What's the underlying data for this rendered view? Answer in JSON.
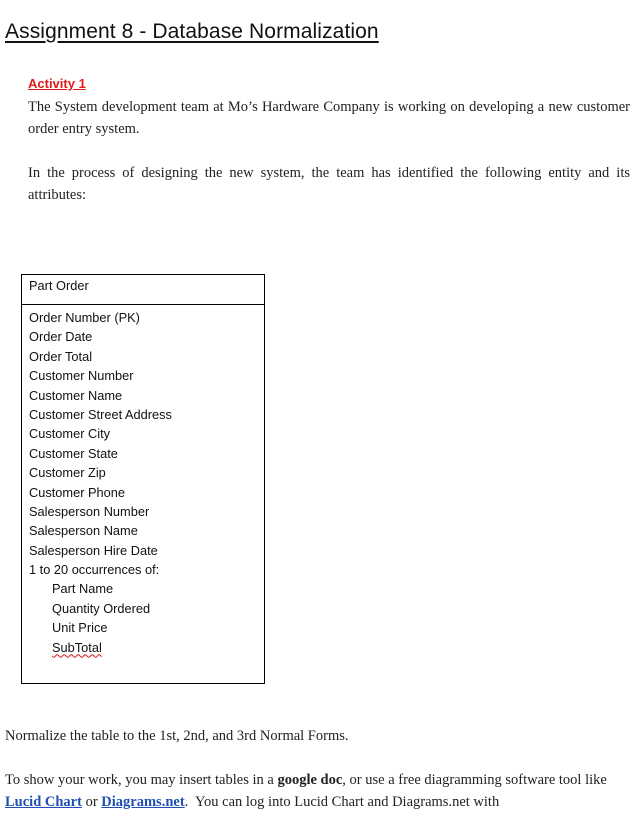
{
  "document": {
    "title": "Assignment 8 - Database Normalization",
    "activity_heading": "Activity 1",
    "intro_paragraph": "The System development team at Mo’s Hardware Company is working on developing a new customer order entry system.",
    "second_paragraph": "In the process of designing the new system, the team has identified the following entity and its attributes:",
    "entity": {
      "name": "Part Order",
      "attributes": [
        {
          "label": "Order Number (PK)",
          "indent": false
        },
        {
          "label": "Order Date",
          "indent": false
        },
        {
          "label": "Order Total",
          "indent": false
        },
        {
          "label": "Customer Number",
          "indent": false
        },
        {
          "label": "Customer Name",
          "indent": false
        },
        {
          "label": "Customer Street Address",
          "indent": false
        },
        {
          "label": "Customer City",
          "indent": false
        },
        {
          "label": "Customer State",
          "indent": false
        },
        {
          "label": "Customer Zip",
          "indent": false
        },
        {
          "label": "Customer Phone",
          "indent": false
        },
        {
          "label": "Salesperson Number",
          "indent": false
        },
        {
          "label": "Salesperson Name",
          "indent": false
        },
        {
          "label": "Salesperson Hire Date",
          "indent": false
        },
        {
          "label": "1 to 20 occurrences of:",
          "indent": false
        },
        {
          "label": "Part Name",
          "indent": true
        },
        {
          "label": "Quantity Ordered",
          "indent": true
        },
        {
          "label": "Unit Price",
          "indent": true
        },
        {
          "label": "SubTotal",
          "indent": true,
          "spellcheck_flag": true
        }
      ]
    },
    "instruction": "Normalize the table to the 1st, 2nd, and 3rd Normal Forms.",
    "work_paragraph": {
      "part1": "To show your work, you may insert tables in a ",
      "bold": "google doc",
      "part2": ", or use a free diagramming software tool like ",
      "link1": "Lucid Chart",
      "part3": " or ",
      "link2": "Diagrams.net",
      "part4": ".  You can log into Lucid Chart and Diagrams.net with"
    },
    "colors": {
      "activity_heading": "#e01b1b",
      "link": "#1f4fb3"
    }
  }
}
